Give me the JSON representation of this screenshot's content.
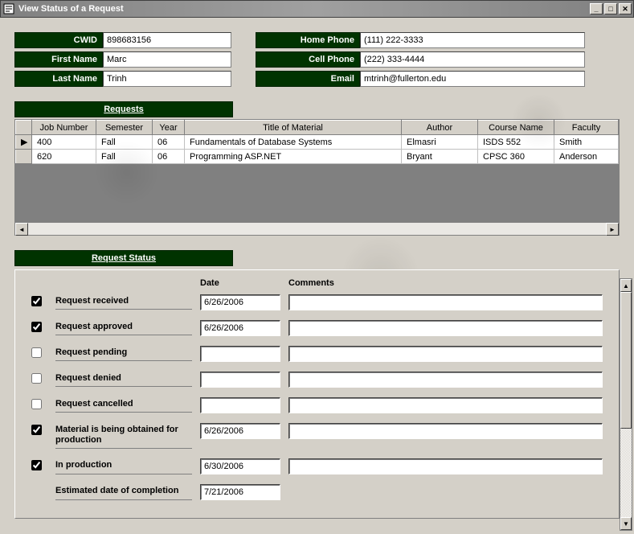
{
  "window": {
    "title": "View Status of a Request"
  },
  "fields": {
    "cwid_label": "CWID",
    "cwid_value": "898683156",
    "first_name_label": "First Name",
    "first_name_value": "Marc",
    "last_name_label": "Last Name",
    "last_name_value": "Trinh",
    "home_phone_label": "Home Phone",
    "home_phone_value": "(111) 222-3333",
    "cell_phone_label": "Cell Phone",
    "cell_phone_value": "(222) 333-4444",
    "email_label": "Email",
    "email_value": "mtrinh@fullerton.edu"
  },
  "requests_header": "Requests",
  "grid": {
    "columns": [
      "",
      "Job Number",
      "Semester",
      "Year",
      "Title of Material",
      "Author",
      "Course Name",
      "Faculty"
    ],
    "rows": [
      {
        "marker": "▶",
        "job": "400",
        "sem": "Fall",
        "year": "06",
        "title": "Fundamentals of Database Systems",
        "author": "Elmasri",
        "course": "ISDS 552",
        "faculty": "Smith"
      },
      {
        "marker": "",
        "job": "620",
        "sem": "Fall",
        "year": "06",
        "title": "Programming ASP.NET",
        "author": "Bryant",
        "course": "CPSC 360",
        "faculty": "Anderson"
      }
    ]
  },
  "status_header": "Request Status",
  "status_cols": {
    "date": "Date",
    "comments": "Comments"
  },
  "status": [
    {
      "checked": true,
      "label": "Request received",
      "date": "6/26/2006",
      "comment": ""
    },
    {
      "checked": true,
      "label": "Request approved",
      "date": "6/26/2006",
      "comment": ""
    },
    {
      "checked": false,
      "label": "Request pending",
      "date": "",
      "comment": ""
    },
    {
      "checked": false,
      "label": "Request denied",
      "date": "",
      "comment": ""
    },
    {
      "checked": false,
      "label": "Request cancelled",
      "date": "",
      "comment": ""
    },
    {
      "checked": true,
      "label": "Material is being obtained for production",
      "date": "6/26/2006",
      "comment": ""
    },
    {
      "checked": true,
      "label": "In production",
      "date": "6/30/2006",
      "comment": ""
    }
  ],
  "completion": {
    "label": "Estimated date of completion",
    "date": "7/21/2006"
  }
}
